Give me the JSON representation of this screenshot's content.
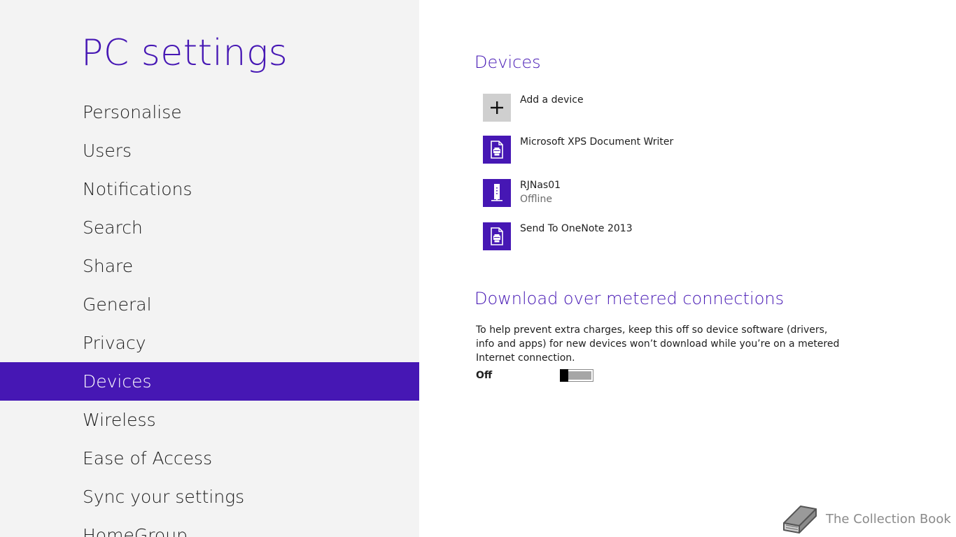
{
  "app": {
    "title": "PC settings",
    "accent_color": "#4617b4"
  },
  "nav": {
    "items": [
      {
        "label": "Personalise"
      },
      {
        "label": "Users"
      },
      {
        "label": "Notifications"
      },
      {
        "label": "Search"
      },
      {
        "label": "Share"
      },
      {
        "label": "General"
      },
      {
        "label": "Privacy"
      },
      {
        "label": "Devices",
        "selected": true
      },
      {
        "label": "Wireless"
      },
      {
        "label": "Ease of Access"
      },
      {
        "label": "Sync your settings"
      },
      {
        "label": "HomeGroup"
      }
    ]
  },
  "devices": {
    "heading": "Devices",
    "add_label": "Add a device",
    "list": [
      {
        "name": "Microsoft XPS Document Writer",
        "icon": "printer-icon"
      },
      {
        "name": "RJNas01",
        "status": "Offline",
        "icon": "nas-icon"
      },
      {
        "name": "Send To OneNote 2013",
        "icon": "printer-icon"
      }
    ]
  },
  "metered": {
    "heading": "Download over metered connections",
    "description": "To help prevent extra charges, keep this off so device software (drivers, info and apps) for new devices won’t download while you’re on a metered Internet connection.",
    "toggle_label": "Off",
    "toggle_on": false
  },
  "watermark": {
    "text": "The Collection Book",
    "icon": "book-icon"
  }
}
